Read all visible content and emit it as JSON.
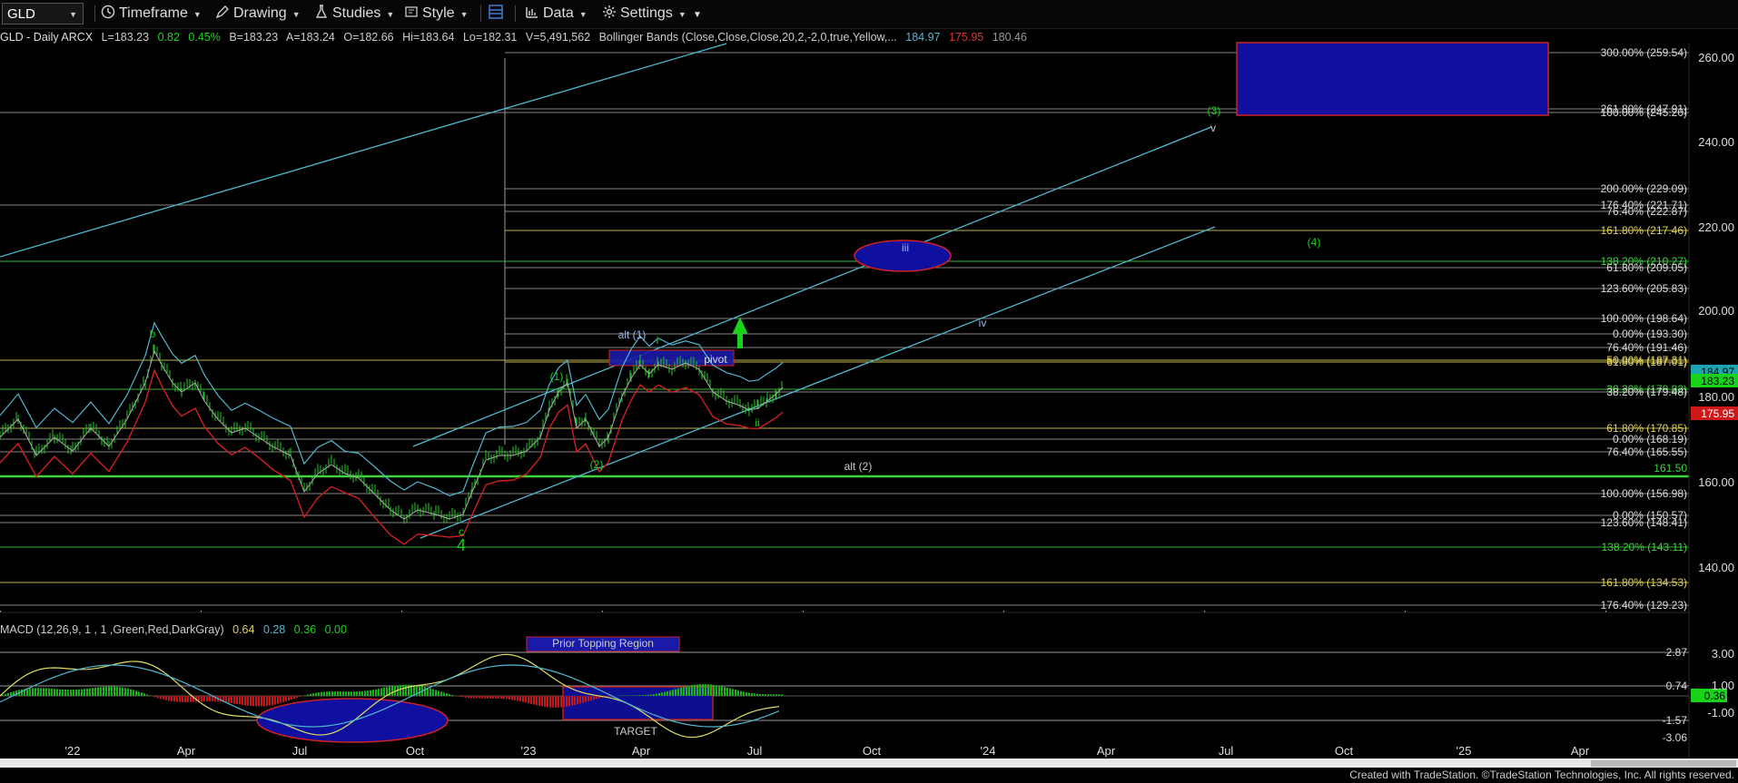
{
  "toolbar": {
    "symbol": "GLD",
    "timeframe": "Timeframe",
    "drawing": "Drawing",
    "studies": "Studies",
    "style": "Style",
    "data": "Data",
    "settings": "Settings"
  },
  "infobar": {
    "title": "GLD - Daily  ARCX",
    "last": "L=183.23",
    "change": "0.82",
    "pct": "0.45%",
    "bid": "B=183.23",
    "ask": "A=183.24",
    "open": "O=182.66",
    "high": "Hi=183.64",
    "low": "Lo=182.31",
    "volume": "V=5,491,562",
    "study": "Bollinger Bands (Close,Close,Close,20,2,-2,0,true,Yellow,...",
    "bb_upper": "184.97",
    "bb_lower": "175.95",
    "bb_mid": "180.46"
  },
  "macd_header": {
    "label": "MACD (12,26,9, 1 , 1 ,Green,Red,DarkGray)",
    "v1": "0.64",
    "v2": "0.28",
    "v3": "0.36",
    "v4": "0.00"
  },
  "colors": {
    "up": "#19d219",
    "down": "#e03030",
    "cyan": "#4fb8d0",
    "level": "#c0c0c0",
    "green_line": "#3ed33e",
    "blue_box": "#1010a0"
  },
  "price_axis": [
    "260.00",
    "240.00",
    "220.00",
    "200.00",
    "180.00",
    "160.00",
    "140.00"
  ],
  "macd_axis": [
    "3.00",
    "1.00",
    "-1.00"
  ],
  "time_axis": [
    "'22",
    "Apr",
    "Jul",
    "Oct",
    "'23",
    "Apr",
    "Jul",
    "Oct",
    "'24",
    "Apr",
    "Jul",
    "Oct",
    "'25",
    "Apr"
  ],
  "fib_levels": [
    {
      "label": "300.00% (259.54)",
      "color": "#dddddd"
    },
    {
      "label": "261.80% (247.91)",
      "color": "#dddddd"
    },
    {
      "label": "100.00% (245.20)",
      "color": "#dddddd"
    },
    {
      "label": "200.00% (229.09)",
      "color": "#dddddd"
    },
    {
      "label": "176.40% (221.71)",
      "color": "#dddddd"
    },
    {
      "label": "76.40% (222.87)",
      "color": "#dddddd"
    },
    {
      "label": "161.80% (217.46)",
      "color": "#e0d060"
    },
    {
      "label": "138.20% (210.27)",
      "color": "#3ed33e"
    },
    {
      "label": "61.80% (209.05)",
      "color": "#dddddd"
    },
    {
      "label": "123.60% (205.83)",
      "color": "#dddddd"
    },
    {
      "label": "100.00% (198.64)",
      "color": "#dddddd"
    },
    {
      "label": "0.00% (193.30)",
      "color": "#dddddd"
    },
    {
      "label": "76.40% (191.46)",
      "color": "#dddddd"
    },
    {
      "label": "50.00% (187.31)",
      "color": "#e0d060"
    },
    {
      "label": "61.80% (187.01)",
      "color": "#e0d060"
    },
    {
      "label": "30.20% (179.82)",
      "color": "#3ed33e"
    },
    {
      "label": "38.20% (179.48)",
      "color": "#dddddd"
    },
    {
      "label": "61.80% (170.85)",
      "color": "#e0d060"
    },
    {
      "label": "0.00% (168.19)",
      "color": "#dddddd"
    },
    {
      "label": "76.40% (165.55)",
      "color": "#dddddd"
    },
    {
      "label": "100.00% (156.98)",
      "color": "#dddddd"
    },
    {
      "label": "0.00% (150.57)",
      "color": "#dddddd"
    },
    {
      "label": "123.60% (148.41)",
      "color": "#dddddd"
    },
    {
      "label": "138.20% (143.11)",
      "color": "#3ed33e"
    },
    {
      "label": "161.80% (134.53)",
      "color": "#e0d060"
    },
    {
      "label": "176.40% (129.23)",
      "color": "#dddddd"
    }
  ],
  "price_flags": [
    {
      "text": "184.97",
      "bg": "#1aa6b0",
      "fg": "#000"
    },
    {
      "text": "183.23",
      "bg": "#19d219",
      "fg": "#000"
    },
    {
      "text": "175.95",
      "bg": "#d01818",
      "fg": "#fff"
    }
  ],
  "green_level": "161.50",
  "macd_levels": [
    "2.87",
    "0.74",
    "0.36",
    "-1.57",
    "-3.06"
  ],
  "annotations": {
    "b": "b",
    "c": "c",
    "four": "4",
    "w1": "(1)",
    "w2": "(2)",
    "alt1": "alt (1)",
    "i": "i",
    "ii": "ii",
    "iii": "iii",
    "iv": "iv",
    "v": "v",
    "w3": "(3)",
    "w4": "(4)",
    "alt2": "alt (2)",
    "pivot": "pivot",
    "prior_top": "Prior Topping Region",
    "target": "TARGET"
  },
  "footer": "Created with TradeStation. ©TradeStation Technologies, Inc. All rights reserved."
}
